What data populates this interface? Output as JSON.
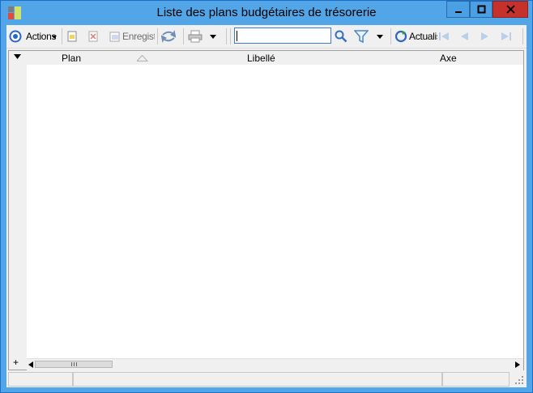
{
  "window": {
    "title": "Liste des plans budgétaires de trésorerie"
  },
  "toolbar": {
    "actions_label": "Actions",
    "save_label": "Enregist",
    "refresh_label": "Actualis",
    "search": {
      "value": "",
      "placeholder": ""
    }
  },
  "grid": {
    "columns": [
      "Plan",
      "Libellé",
      "Axe"
    ],
    "rows": []
  },
  "status": {
    "cells": [
      "",
      "",
      ""
    ]
  },
  "colors": {
    "titlebar": "#52a5e6",
    "close": "#c7312b",
    "accent": "#3d7bd1"
  }
}
